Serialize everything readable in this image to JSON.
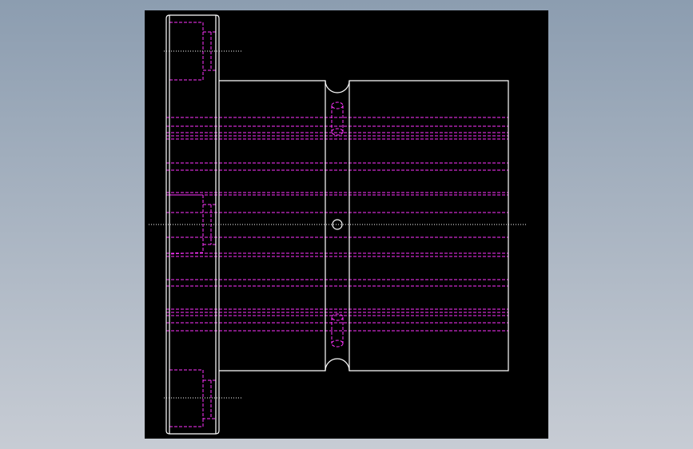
{
  "viewport": {
    "background_top": "#8c9db0",
    "background_bottom": "#c7ccd4"
  },
  "sheet": {
    "background": "#000000"
  },
  "colors": {
    "outline": "#ffffff",
    "hidden_line": "#ff33ff",
    "center_line": "#ffffff"
  }
}
